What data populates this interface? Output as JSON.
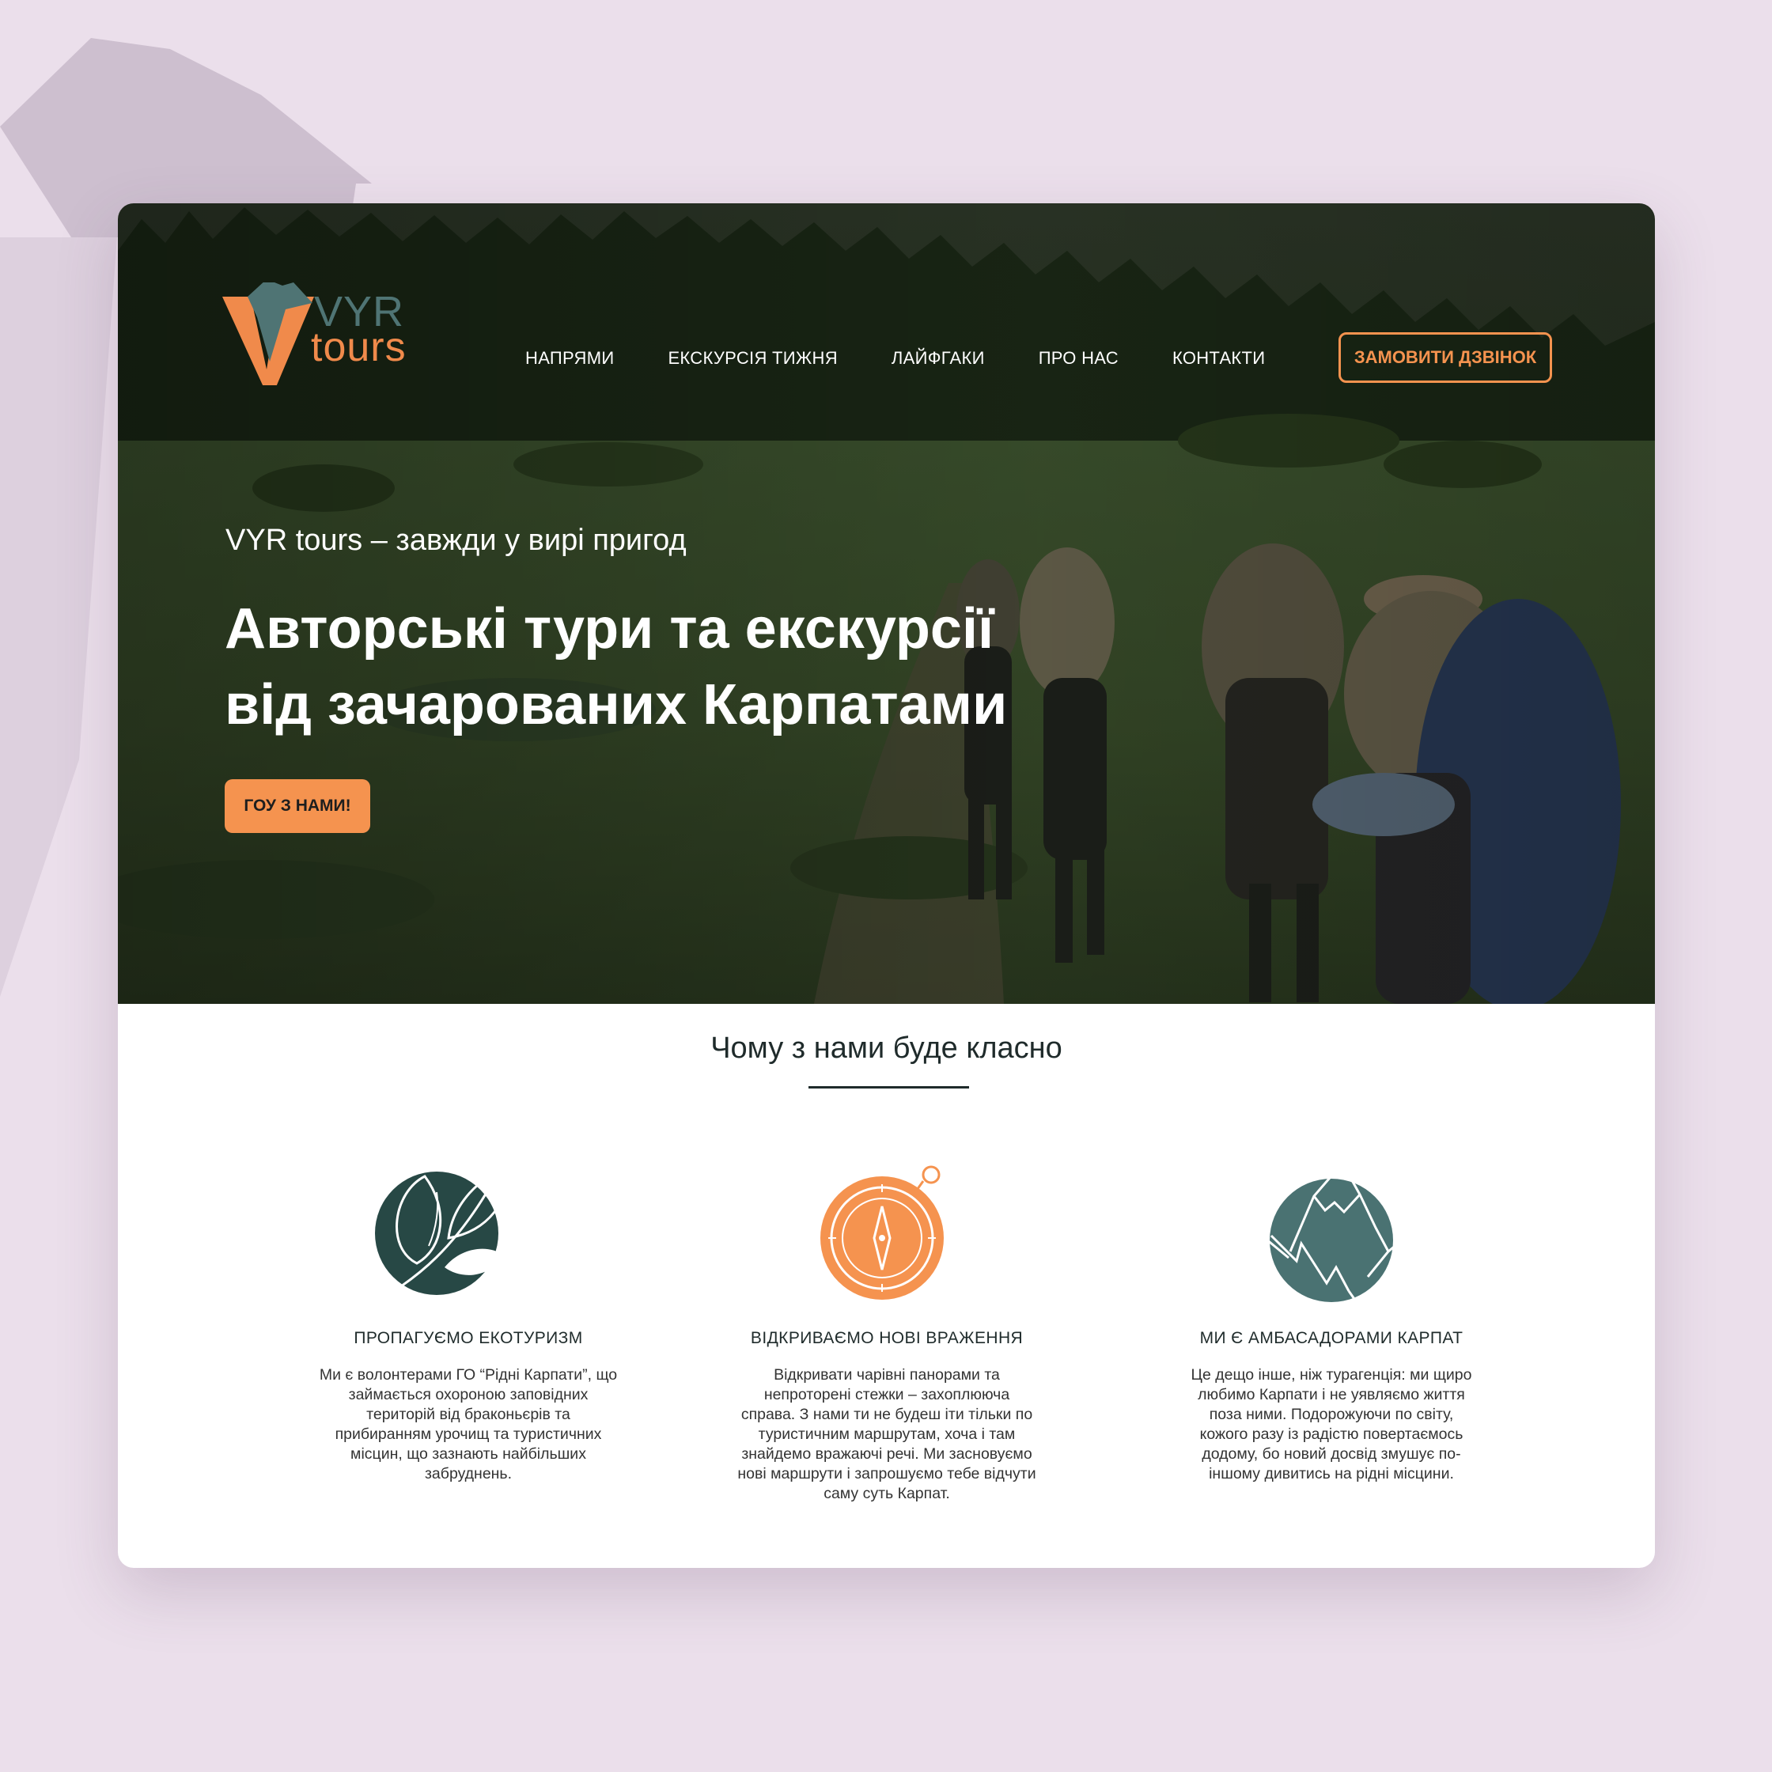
{
  "colors": {
    "page_background": "#ebdfeb",
    "accent_orange": "#f5934f",
    "logo_teal": "#4f7474",
    "icon_dark_green": "#274845",
    "icon_teal": "#4a7272",
    "text_dark": "#1f2b2b"
  },
  "logo": {
    "line1": "VYR",
    "line2": "tours"
  },
  "nav": {
    "items": [
      {
        "label": "НАПРЯМИ"
      },
      {
        "label": "ЕКСКУРСІЯ ТИЖНЯ"
      },
      {
        "label": "ЛАЙФГАКИ"
      },
      {
        "label": "ПРО НАС"
      },
      {
        "label": "КОНТАКТИ"
      }
    ],
    "call_button": "ЗАМОВИТИ ДЗВІНОК"
  },
  "hero": {
    "tagline": "VYR tours – завжди у вирі пригод",
    "headline_line1": "Авторські тури та екскурсії",
    "headline_line2": "від зачарованих Карпатами",
    "cta": "ГОУ З НАМИ!"
  },
  "why": {
    "title": "Чому з нами буде класно",
    "features": [
      {
        "icon": "leaf-icon",
        "title": "ПРОПАГУЄМО ЕКОТУРИЗМ",
        "lines": [
          "Ми є волонтерами ГО “Рідні Карпати”, що",
          "займається охороною заповідних",
          "територій від браконьєрів та",
          "прибиранням урочищ та туристичних",
          "місцин, що зазнають найбільших",
          "забруднень."
        ]
      },
      {
        "icon": "compass-icon",
        "title": "ВІДКРИВАЄМО НОВІ ВРАЖЕННЯ",
        "lines": [
          "Відкривати чарівні панорами та",
          "непроторені стежки – захоплююча",
          "справа. З нами ти не будеш іти тільки по",
          "туристичним маршрутам, хоча і там",
          "знайдемо вражаючі речі. Ми засновуємо",
          "нові маршрути і запрошуємо тебе відчути",
          "саму суть Карпат."
        ]
      },
      {
        "icon": "mountain-icon",
        "title": "МИ Є АМБАСАДОРАМИ КАРПАТ",
        "lines": [
          "Це дещо інше, ніж турагенція: ми щиро",
          "любимо Карпати і не уявляємо життя",
          "поза ними. Подорожуючи по світу,",
          "кожого разу із радістю повертаємось",
          "додому, бо новий досвід змушує по-",
          "іншому дивитись на рідні місцини."
        ]
      }
    ]
  }
}
